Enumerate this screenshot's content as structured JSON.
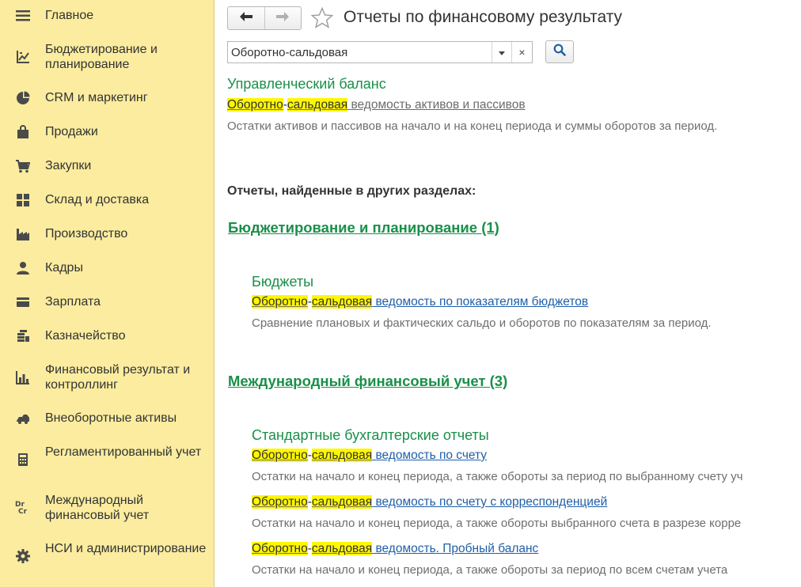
{
  "sidebar": {
    "items": [
      {
        "label": "Главное",
        "icon": "hamburger-icon"
      },
      {
        "label": "Бюджетирование и планирование",
        "icon": "budget-chart-icon"
      },
      {
        "label": "CRM и маркетинг",
        "icon": "pie-chart-icon"
      },
      {
        "label": "Продажи",
        "icon": "shopping-bag-icon"
      },
      {
        "label": "Закупки",
        "icon": "shopping-cart-icon"
      },
      {
        "label": "Склад и доставка",
        "icon": "warehouse-grid-icon"
      },
      {
        "label": "Производство",
        "icon": "factory-icon"
      },
      {
        "label": "Кадры",
        "icon": "person-icon"
      },
      {
        "label": "Зарплата",
        "icon": "wallet-card-icon"
      },
      {
        "label": "Казначейство",
        "icon": "coins-stack-icon"
      },
      {
        "label": "Финансовый результат и контроллинг",
        "icon": "bar-chart-icon"
      },
      {
        "label": "Внеоборотные активы",
        "icon": "truck-icon"
      },
      {
        "label": "Регламентированный учет",
        "icon": "calculator-icon"
      },
      {
        "label": "Международный финансовый учет",
        "icon": "dr-cr-icon",
        "icon_text": "Dr Cr"
      },
      {
        "label": "НСИ и администрирование",
        "icon": "gear-icon"
      }
    ]
  },
  "header": {
    "back_icon": "arrow-left-icon",
    "forward_icon": "arrow-right-icon",
    "favorite_icon": "star-outline-icon",
    "title": "Отчеты по финансовому результату"
  },
  "search": {
    "value": "Оборотно-сальдовая",
    "dropdown_icon": "chevron-down-icon",
    "clear_symbol": "×",
    "search_icon": "magnifier-icon"
  },
  "local_group": {
    "title": "Управленческий баланс",
    "report": {
      "hl1": "Оборотно",
      "sep": "-",
      "hl2": "сальдовая",
      "rest": " ведомость активов и пассивов",
      "desc": "Остатки активов и пассивов на начало и на конец периода и суммы оборотов за период."
    }
  },
  "other_sections_heading": "Отчеты, найденные в других разделах:",
  "sections": [
    {
      "title": "Бюджетирование и планирование (1)",
      "group_title": "Бюджеты",
      "reports": [
        {
          "hl1": "Оборотно",
          "sep": "-",
          "hl2": "сальдовая",
          "rest": " ведомость по показателям бюджетов",
          "desc": "Сравнение плановых и фактических сальдо и оборотов по показателям за период."
        }
      ]
    },
    {
      "title": "Международный финансовый учет (3)",
      "group_title": "Стандартные бухгалтерские отчеты",
      "reports": [
        {
          "hl1": "Оборотно",
          "sep": "-",
          "hl2": "сальдовая",
          "rest": " ведомость по счету",
          "desc": "Остатки на начало и конец периода, а также обороты за период по выбранному счету уч"
        },
        {
          "hl1": "Оборотно",
          "sep": "-",
          "hl2": "сальдовая",
          "rest": " ведомость по счету с корреспонденцией",
          "desc": "Остатки на начало и конец периода, а также обороты выбранного счета в разрезе корре"
        },
        {
          "hl1": "Оборотно",
          "sep": "-",
          "hl2": "сальдовая",
          "rest": " ведомость. Пробный баланс",
          "desc": "Остатки на начало и конец периода, а также обороты за период по всем счетам учета"
        }
      ]
    }
  ]
}
